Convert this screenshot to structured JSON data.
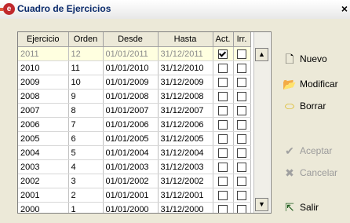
{
  "window": {
    "title": "Cuadro de Ejercicios",
    "close_glyph": "×",
    "icon": "app-red-circle-icon"
  },
  "table": {
    "columns": [
      "Ejercicio",
      "Orden",
      "Desde",
      "Hasta",
      "Act.",
      "Irr."
    ],
    "rows": [
      {
        "ejercicio": "2011",
        "orden": "12",
        "desde": "01/01/2011",
        "hasta": "31/12/2011",
        "act": true,
        "irr": false,
        "selected": true
      },
      {
        "ejercicio": "2010",
        "orden": "11",
        "desde": "01/01/2010",
        "hasta": "31/12/2010",
        "act": false,
        "irr": false
      },
      {
        "ejercicio": "2009",
        "orden": "10",
        "desde": "01/01/2009",
        "hasta": "31/12/2009",
        "act": false,
        "irr": false
      },
      {
        "ejercicio": "2008",
        "orden": "9",
        "desde": "01/01/2008",
        "hasta": "31/12/2008",
        "act": false,
        "irr": false
      },
      {
        "ejercicio": "2007",
        "orden": "8",
        "desde": "01/01/2007",
        "hasta": "31/12/2007",
        "act": false,
        "irr": false
      },
      {
        "ejercicio": "2006",
        "orden": "7",
        "desde": "01/01/2006",
        "hasta": "31/12/2006",
        "act": false,
        "irr": false
      },
      {
        "ejercicio": "2005",
        "orden": "6",
        "desde": "01/01/2005",
        "hasta": "31/12/2005",
        "act": false,
        "irr": false
      },
      {
        "ejercicio": "2004",
        "orden": "5",
        "desde": "01/01/2004",
        "hasta": "31/12/2004",
        "act": false,
        "irr": false
      },
      {
        "ejercicio": "2003",
        "orden": "4",
        "desde": "01/01/2003",
        "hasta": "31/12/2003",
        "act": false,
        "irr": false
      },
      {
        "ejercicio": "2002",
        "orden": "3",
        "desde": "01/01/2002",
        "hasta": "31/12/2002",
        "act": false,
        "irr": false
      },
      {
        "ejercicio": "2001",
        "orden": "2",
        "desde": "01/01/2001",
        "hasta": "31/12/2001",
        "act": false,
        "irr": false
      },
      {
        "ejercicio": "2000",
        "orden": "1",
        "desde": "01/01/2000",
        "hasta": "31/12/2000",
        "act": false,
        "irr": false
      }
    ]
  },
  "buttons": {
    "nuevo": {
      "label": "Nuevo",
      "icon": "new-document-icon",
      "enabled": true
    },
    "modificar": {
      "label": "Modificar",
      "icon": "open-folder-icon",
      "enabled": true
    },
    "borrar": {
      "label": "Borrar",
      "icon": "eraser-icon",
      "enabled": true
    },
    "aceptar": {
      "label": "Aceptar",
      "icon": "check-icon",
      "enabled": false
    },
    "cancelar": {
      "label": "Cancelar",
      "icon": "cancel-x-icon",
      "enabled": false
    },
    "salir": {
      "label": "Salir",
      "icon": "exit-icon",
      "enabled": true
    }
  },
  "colors": {
    "selected_row": "#ffffe0",
    "title_text": "#0a2a6b",
    "app_icon": "#c0282d"
  }
}
